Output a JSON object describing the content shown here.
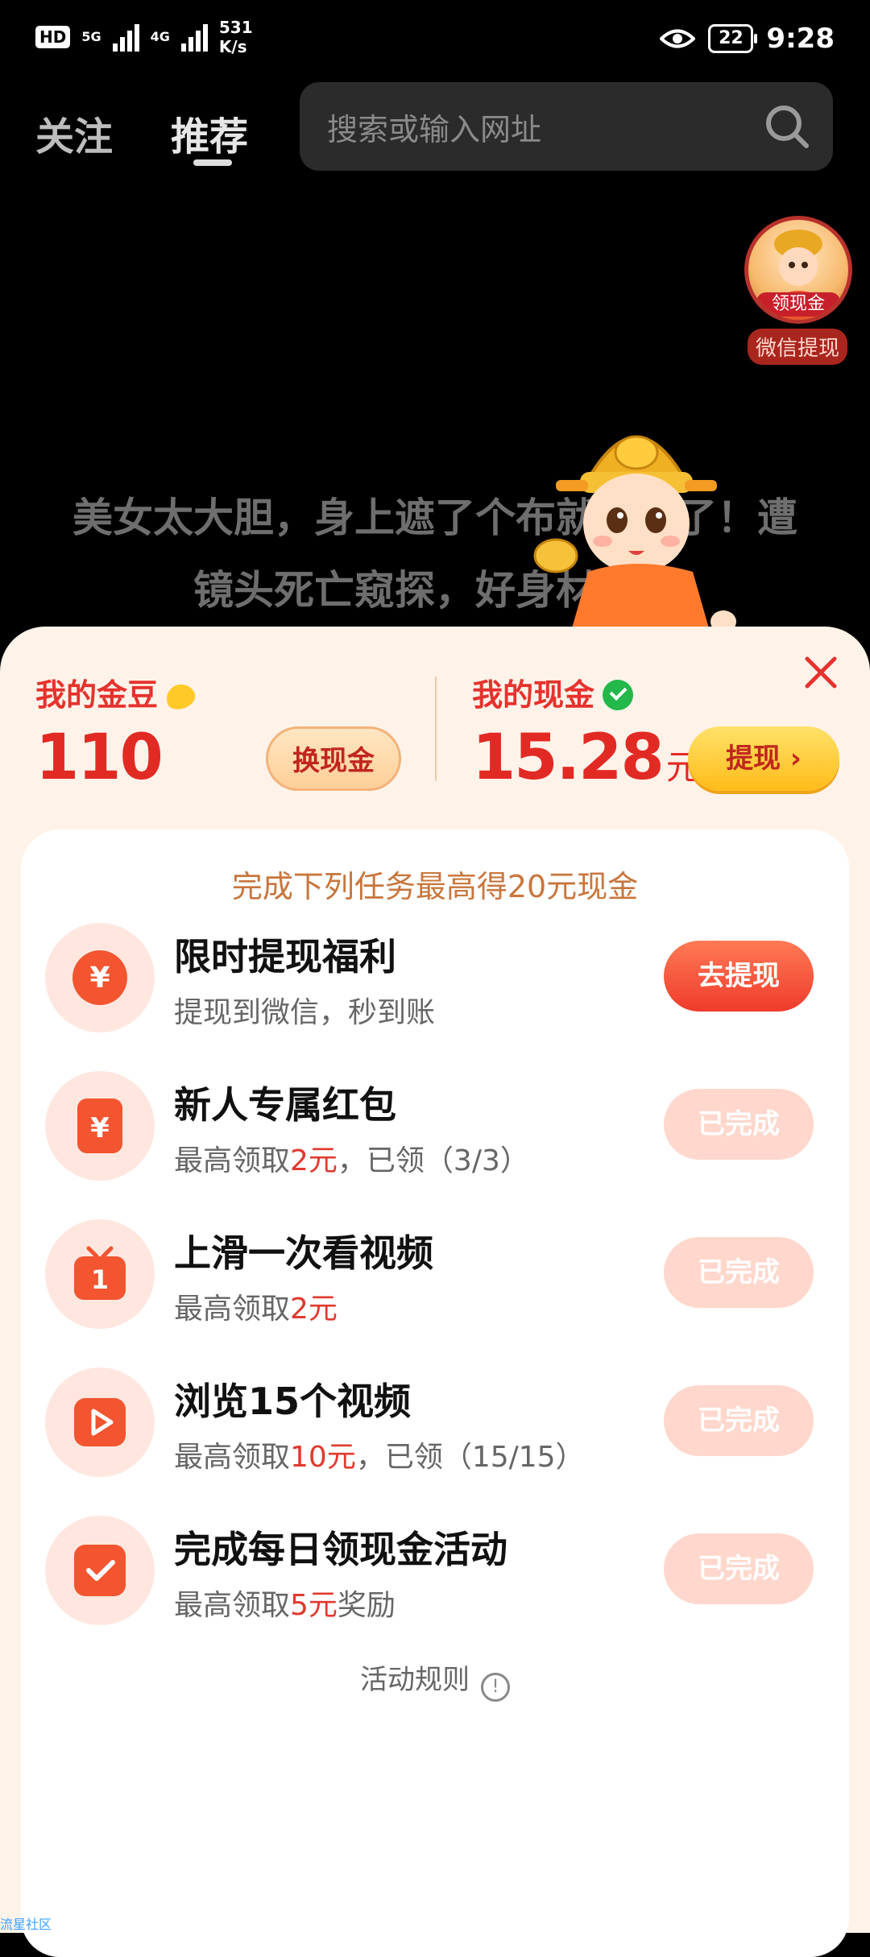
{
  "status_bar": {
    "hd": "HD",
    "sim1_net": "5G",
    "sim2_net": "4G",
    "speed_value": "531",
    "speed_unit": "K/s",
    "battery": "22",
    "time": "9:28"
  },
  "nav": {
    "tab_follow": "关注",
    "tab_recommend": "推荐",
    "search_placeholder": "搜索或输入网址"
  },
  "coin_widget": {
    "badge": "领现金",
    "caption": "微信提现"
  },
  "video": {
    "caption_line1": "美女太大胆，身上遮了个布就出来了！遭",
    "caption_line2": "镜头死亡窥探，好身材大赏"
  },
  "wallet": {
    "beans_label": "我的金豆",
    "beans_value": "110",
    "exchange_button": "换现金",
    "cash_label": "我的现金",
    "cash_value": "15.28",
    "cash_unit": "元",
    "withdraw_button": "提现 ›"
  },
  "tasks_card": {
    "heading": "完成下列任务最高得20元现金",
    "rules": "活动规则",
    "tasks": [
      {
        "title": "限时提现福利",
        "desc_pre": "提现到微信，秒到账",
        "desc_hl": "",
        "desc_post": "",
        "button": "去提现",
        "icon": "yen-coin-icon"
      },
      {
        "title": "新人专属红包",
        "desc_pre": "最高领取",
        "desc_hl": "2元",
        "desc_post": "，已领（3/3）",
        "button": "已完成",
        "icon": "red-envelope-icon"
      },
      {
        "title": "上滑一次看视频",
        "desc_pre": "最高领取",
        "desc_hl": "2元",
        "desc_post": "",
        "button": "已完成",
        "icon": "tv-icon"
      },
      {
        "title": "浏览15个视频",
        "desc_pre": "最高领取",
        "desc_hl": "10元",
        "desc_post": "，已领（15/15）",
        "button": "已完成",
        "icon": "play-icon"
      },
      {
        "title": "完成每日领现金活动",
        "desc_pre": "最高领取",
        "desc_hl": "5元",
        "desc_post": "奖励",
        "button": "已完成",
        "icon": "check-icon"
      }
    ]
  },
  "watermark": "流星社区",
  "colors": {
    "accent_red": "#e22a24",
    "gold": "#ffc928",
    "sheet_bg": "#fff3e9"
  }
}
